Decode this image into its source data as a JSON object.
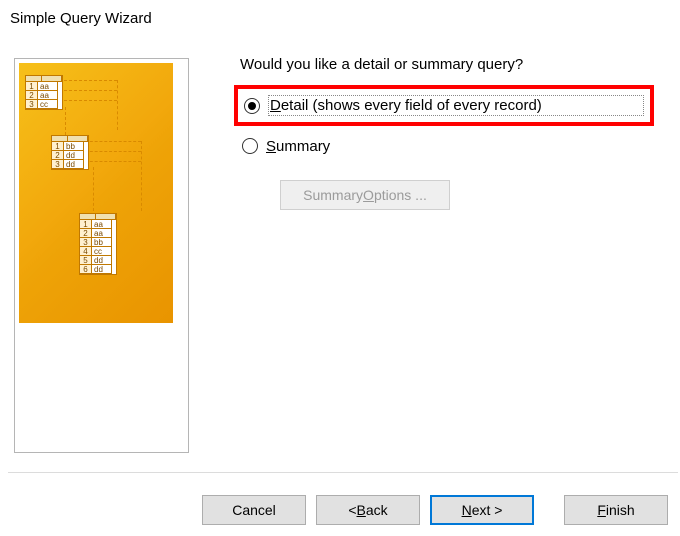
{
  "window": {
    "title": "Simple Query Wizard"
  },
  "question": "Would you like a detail or summary query?",
  "options": {
    "detail": {
      "selected": true,
      "mnemonic": "D",
      "rest": "etail (shows every field of every record)"
    },
    "summary": {
      "selected": false,
      "mnemonic": "S",
      "rest": "ummary"
    }
  },
  "summary_options_button": {
    "label_pre": "Summary ",
    "mnemonic": "O",
    "label_post": "ptions ...",
    "enabled": false
  },
  "preview": {
    "table1": [
      {
        "n": "1",
        "v": "aa"
      },
      {
        "n": "2",
        "v": "aa"
      },
      {
        "n": "3",
        "v": "cc"
      }
    ],
    "table2": [
      {
        "n": "1",
        "v": "bb"
      },
      {
        "n": "2",
        "v": "dd"
      },
      {
        "n": "3",
        "v": "dd"
      }
    ],
    "table3": [
      {
        "n": "1",
        "v": "aa"
      },
      {
        "n": "2",
        "v": "aa"
      },
      {
        "n": "3",
        "v": "bb"
      },
      {
        "n": "4",
        "v": "cc"
      },
      {
        "n": "5",
        "v": "dd"
      },
      {
        "n": "6",
        "v": "dd"
      }
    ]
  },
  "footer": {
    "cancel": "Cancel",
    "back_pre": "< ",
    "back_mn": "B",
    "back_post": "ack",
    "next_mn": "N",
    "next_post": "ext >",
    "finish_mn": "F",
    "finish_post": "inish"
  }
}
